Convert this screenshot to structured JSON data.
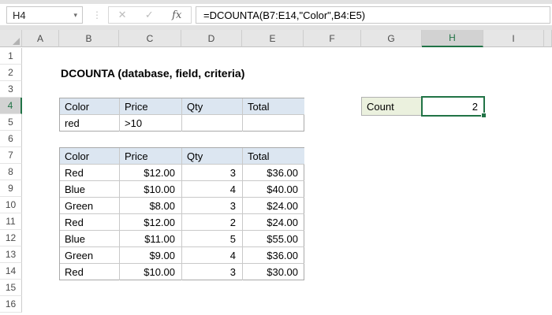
{
  "formula_bar": {
    "name_box": "H4",
    "name_box_dropdown_icon": "▾",
    "more_icon": "⋮",
    "cancel_icon": "✕",
    "enter_icon": "✓",
    "fx_icon": "fx",
    "formula": "=DCOUNTA(B7:E14,\"Color\",B4:E5)"
  },
  "sheet": {
    "column_headers": [
      "A",
      "B",
      "C",
      "D",
      "E",
      "F",
      "G",
      "H",
      "I"
    ],
    "row_headers": [
      "1",
      "2",
      "3",
      "4",
      "5",
      "6",
      "7",
      "8",
      "9",
      "10",
      "11",
      "12",
      "13",
      "14",
      "15",
      "16"
    ],
    "selected_cell": "H4",
    "selected_column": "H",
    "selected_row": "4"
  },
  "cells": {
    "title": "DCOUNTA (database, field, criteria)",
    "count_label": "Count",
    "count_value": "2"
  },
  "criteria_table": {
    "range": "B4:E5",
    "headers": [
      "Color",
      "Price",
      "Qty",
      "Total"
    ],
    "rows": [
      [
        "red",
        ">10",
        "",
        ""
      ]
    ]
  },
  "data_table": {
    "range": "B7:E14",
    "headers": [
      "Color",
      "Price",
      "Qty",
      "Total"
    ],
    "rows": [
      [
        "Red",
        "$12.00",
        "3",
        "$36.00"
      ],
      [
        "Blue",
        "$10.00",
        "4",
        "$40.00"
      ],
      [
        "Green",
        "$8.00",
        "3",
        "$24.00"
      ],
      [
        "Red",
        "$12.00",
        "2",
        "$24.00"
      ],
      [
        "Blue",
        "$11.00",
        "5",
        "$55.00"
      ],
      [
        "Green",
        "$9.00",
        "4",
        "$36.00"
      ],
      [
        "Red",
        "$10.00",
        "3",
        "$30.00"
      ]
    ]
  },
  "colors": {
    "accent_green": "#217346",
    "table_header_fill": "#dce6f1",
    "count_fill": "#ebf1de",
    "header_bg": "#e6e6e6",
    "selected_header_bg": "#d2d2d2"
  }
}
